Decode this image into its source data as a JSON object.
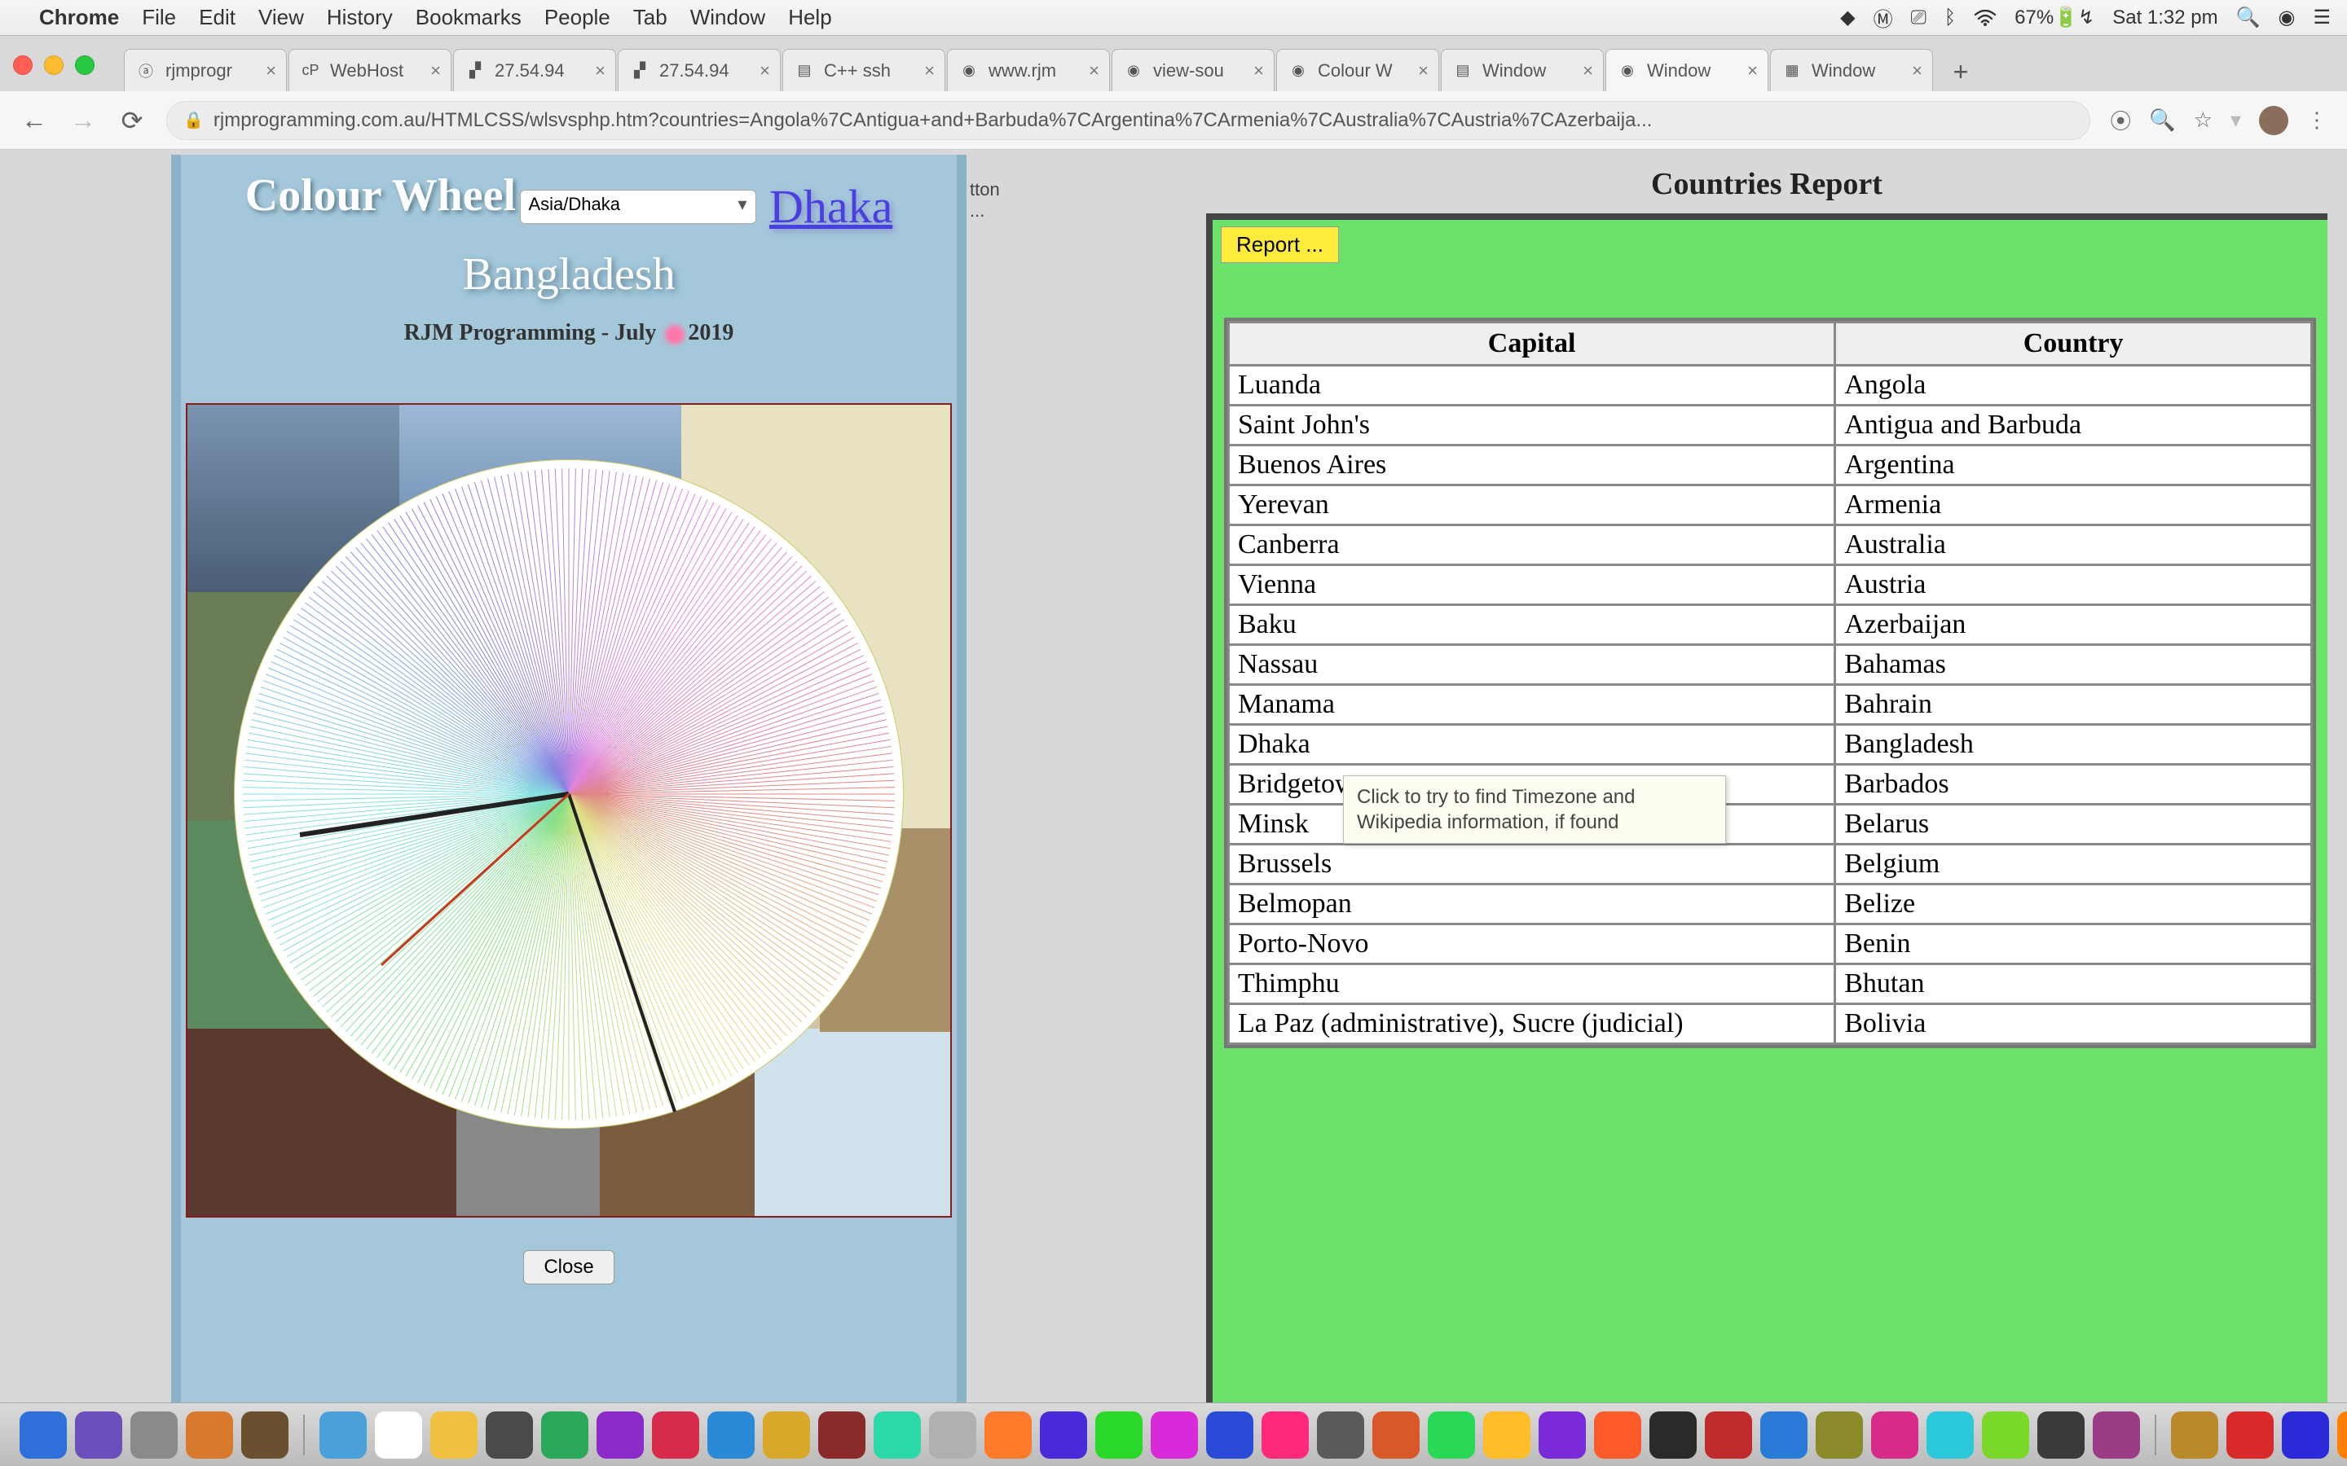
{
  "menubar": {
    "app": "Chrome",
    "items": [
      "File",
      "Edit",
      "View",
      "History",
      "Bookmarks",
      "People",
      "Tab",
      "Window",
      "Help"
    ],
    "battery": "67%",
    "clock": "Sat 1:32 pm"
  },
  "tabs": [
    {
      "label": "rjmprogr",
      "icon": "ⓐ"
    },
    {
      "label": "WebHost",
      "icon": "cP"
    },
    {
      "label": "27.54.94",
      "icon": "▞"
    },
    {
      "label": "27.54.94",
      "icon": "▞"
    },
    {
      "label": "C++ ssh",
      "icon": "▤"
    },
    {
      "label": "www.rjm",
      "icon": "◉"
    },
    {
      "label": "view-sou",
      "icon": "◉"
    },
    {
      "label": "Colour W",
      "icon": "◉"
    },
    {
      "label": "Window",
      "icon": "▤"
    },
    {
      "label": "Window",
      "icon": "◉",
      "active": true
    },
    {
      "label": "Window",
      "icon": "▦"
    }
  ],
  "url": "rjmprogramming.com.au/HTMLCSS/wlsvsphp.htm?countries=Angola%7CAntigua+and+Barbuda%7CArgentina%7CArmenia%7CAustralia%7CAustria%7CAzerbaija...",
  "midstrip": "tton ...",
  "colourwheel": {
    "title": "Colour Wheel",
    "tz": "Asia/Dhaka",
    "city": "Dhaka",
    "country": "Bangladesh",
    "subline_prefix": "RJM Programming - July ",
    "subline_suffix": "2019",
    "close": "Close"
  },
  "report": {
    "title": "Countries Report",
    "button": "Report ...",
    "headers": {
      "capital": "Capital",
      "country": "Country"
    },
    "rows": [
      {
        "capital": "Luanda",
        "country": "Angola"
      },
      {
        "capital": "Saint John's",
        "country": "Antigua and Barbuda"
      },
      {
        "capital": "Buenos Aires",
        "country": "Argentina"
      },
      {
        "capital": "Yerevan",
        "country": "Armenia"
      },
      {
        "capital": "Canberra",
        "country": "Australia"
      },
      {
        "capital": "Vienna",
        "country": "Austria"
      },
      {
        "capital": "Baku",
        "country": "Azerbaijan"
      },
      {
        "capital": "Nassau",
        "country": "Bahamas"
      },
      {
        "capital": "Manama",
        "country": "Bahrain"
      },
      {
        "capital": "Dhaka",
        "country": "Bangladesh"
      },
      {
        "capital": "Bridgetown",
        "country": "Barbados"
      },
      {
        "capital": "Minsk",
        "country": "Belarus"
      },
      {
        "capital": "Brussels",
        "country": "Belgium"
      },
      {
        "capital": "Belmopan",
        "country": "Belize"
      },
      {
        "capital": "Porto-Novo",
        "country": "Benin"
      },
      {
        "capital": "Thimphu",
        "country": "Bhutan"
      },
      {
        "capital": "La Paz (administrative), Sucre (judicial)",
        "country": "Bolivia"
      }
    ],
    "tooltip": "Click to try to find Timezone and Wikipedia information, if found"
  },
  "dock_icons": [
    "#2e6fdc",
    "#6b4fbd",
    "#8a8a8a",
    "#d87a2e",
    "#6b5030",
    "#4aa0d8",
    "#ffffff",
    "#f0c040",
    "#4a4a4a",
    "#2aa85a",
    "#8a2ac8",
    "#d82a4a",
    "#2a8ad8",
    "#d8a82a",
    "#8a2a2a",
    "#2ad8a8",
    "#b0b0b0",
    "#ff7a2a",
    "#4a2ad8",
    "#2ad82a",
    "#d82ad8",
    "#2a4ad8",
    "#ff2a7a",
    "#5a5a5a",
    "#d8582a",
    "#2ad858",
    "#ffbd2a",
    "#7a2ad8",
    "#ff5a2a",
    "#2a2a2a",
    "#c02a2a",
    "#2a7ad8",
    "#8a8a2a",
    "#d82a8a",
    "#2ac8d8",
    "#7ad82a",
    "#3a3a3a",
    "#9B3C86",
    "#ba8a2a",
    "#d82a2a",
    "#2a2ad8",
    "#ff8000"
  ]
}
